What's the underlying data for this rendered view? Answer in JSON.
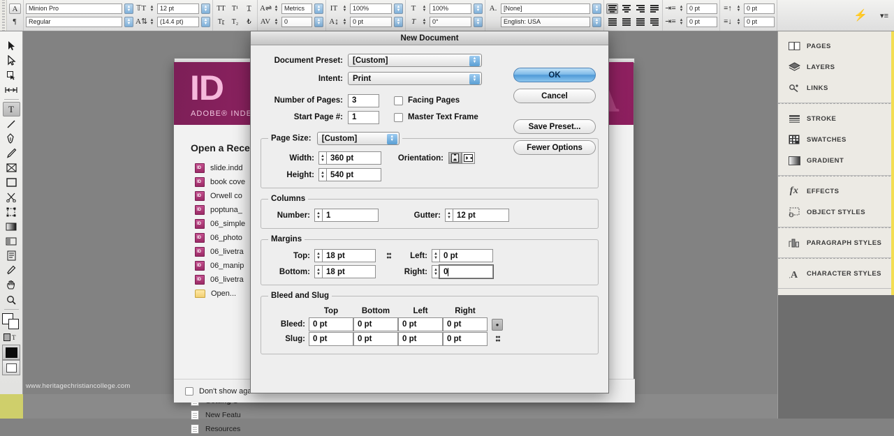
{
  "app": {
    "name": "Adobe InDesign",
    "watermark": "www.heritagechristiancollege.com"
  },
  "control_bar": {
    "font_family": "Minion Pro",
    "font_style": "Regular",
    "font_size": "12 pt",
    "leading": "(14.4 pt)",
    "kerning": "Metrics",
    "tracking": "0",
    "vertical_scale": "100%",
    "horizontal_scale": "100%",
    "baseline_shift": "0 pt",
    "skew": "0°",
    "character_style": "[None]",
    "language": "English: USA",
    "indent_left": "0 pt",
    "indent_first": "0 pt",
    "space_before": "0 pt",
    "space_after": "0 pt"
  },
  "toolbox": {
    "tools": [
      {
        "name": "selection-tool",
        "glyph": "⮝"
      },
      {
        "name": "direct-selection-tool",
        "glyph": "⮝"
      },
      {
        "name": "page-tool",
        "glyph": "◱"
      },
      {
        "name": "gap-tool",
        "glyph": "↔"
      },
      {
        "name": "type-tool",
        "glyph": "T",
        "selected": true
      },
      {
        "name": "line-tool",
        "glyph": "╱"
      },
      {
        "name": "pen-tool",
        "glyph": "✒"
      },
      {
        "name": "pencil-tool",
        "glyph": "✎"
      },
      {
        "name": "rectangle-frame-tool",
        "glyph": "⌧"
      },
      {
        "name": "rectangle-tool",
        "glyph": "▭"
      },
      {
        "name": "scissors-tool",
        "glyph": "✂"
      },
      {
        "name": "free-transform-tool",
        "glyph": "⬚"
      },
      {
        "name": "gradient-swatch-tool",
        "glyph": "▤"
      },
      {
        "name": "gradient-feather-tool",
        "glyph": "▧"
      },
      {
        "name": "note-tool",
        "glyph": "☰"
      },
      {
        "name": "eyedropper-tool",
        "glyph": "✒"
      },
      {
        "name": "hand-tool",
        "glyph": "✋"
      },
      {
        "name": "zoom-tool",
        "glyph": "⌕"
      }
    ]
  },
  "dock": {
    "groups": [
      {
        "items": [
          {
            "label": "PAGES",
            "icon": "pages-icon"
          },
          {
            "label": "LAYERS",
            "icon": "layers-icon"
          },
          {
            "label": "LINKS",
            "icon": "links-icon"
          }
        ]
      },
      {
        "items": [
          {
            "label": "STROKE",
            "icon": "stroke-icon"
          },
          {
            "label": "SWATCHES",
            "icon": "swatches-icon"
          },
          {
            "label": "GRADIENT",
            "icon": "gradient-icon"
          }
        ]
      },
      {
        "items": [
          {
            "label": "EFFECTS",
            "icon": "effects-icon"
          },
          {
            "label": "OBJECT STYLES",
            "icon": "object-styles-icon"
          }
        ]
      },
      {
        "items": [
          {
            "label": "PARAGRAPH STYLES",
            "icon": "paragraph-styles-icon"
          }
        ]
      },
      {
        "items": [
          {
            "label": "CHARACTER STYLES",
            "icon": "character-styles-icon"
          }
        ]
      }
    ]
  },
  "welcome": {
    "banner_logo": "ID",
    "banner_product": "ADOBE® INDE",
    "recent_title": "Open a Rece",
    "recent_files": [
      "slide.indd",
      "book cove",
      "Orwell co",
      "poptuna_",
      "06_simple",
      "06_photo",
      "06_livetra",
      "06_manip",
      "06_livetra"
    ],
    "open_label": "Open...",
    "help_items": [
      "Getting S",
      "New Featu",
      "Resources"
    ],
    "dont_show_label": "Don't show again"
  },
  "dialog": {
    "title": "New Document",
    "document_preset": {
      "label": "Document Preset:",
      "value": "[Custom]"
    },
    "intent": {
      "label": "Intent:",
      "value": "Print"
    },
    "number_of_pages": {
      "label": "Number of Pages:",
      "value": "3"
    },
    "start_page": {
      "label": "Start Page #:",
      "value": "1"
    },
    "facing_pages": {
      "label": "Facing Pages",
      "checked": false
    },
    "master_text_frame": {
      "label": "Master Text Frame",
      "checked": false
    },
    "buttons": {
      "ok": "OK",
      "cancel": "Cancel",
      "save_preset": "Save Preset...",
      "fewer_options": "Fewer Options"
    },
    "page_size": {
      "legend": "Page Size:",
      "value": "[Custom]",
      "width_label": "Width:",
      "width_value": "360 pt",
      "height_label": "Height:",
      "height_value": "540 pt",
      "orientation_label": "Orientation:",
      "orientation_selected": "portrait"
    },
    "columns": {
      "legend": "Columns",
      "number_label": "Number:",
      "number_value": "1",
      "gutter_label": "Gutter:",
      "gutter_value": "12 pt"
    },
    "margins": {
      "legend": "Margins",
      "top_label": "Top:",
      "top_value": "18 pt",
      "bottom_label": "Bottom:",
      "bottom_value": "18 pt",
      "left_label": "Left:",
      "left_value": "0 pt",
      "right_label": "Right:",
      "right_value": "0"
    },
    "bleed_and_slug": {
      "legend": "Bleed and Slug",
      "columns": [
        "Top",
        "Bottom",
        "Left",
        "Right"
      ],
      "rows": [
        {
          "label": "Bleed:",
          "values": [
            "0 pt",
            "0 pt",
            "0 pt",
            "0 pt"
          ]
        },
        {
          "label": "Slug:",
          "values": [
            "0 pt",
            "0 pt",
            "0 pt",
            "0 pt"
          ]
        }
      ]
    }
  },
  "colors": {
    "accent_blue": "#5a9fd4",
    "banner_magenta": "#9b2468",
    "highlight_yellow": "#f3dd52",
    "canvas_gray": "#828282"
  }
}
